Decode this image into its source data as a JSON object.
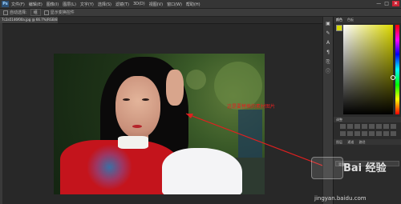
{
  "menubar": {
    "logo": "Ps",
    "items": [
      "文件(F)",
      "编辑(E)",
      "图像(I)",
      "图层(L)",
      "文字(Y)",
      "选择(S)",
      "滤镜(T)",
      "3D(D)",
      "视图(V)",
      "窗口(W)",
      "帮助(H)"
    ],
    "window_controls": [
      "—",
      "□",
      "✕"
    ]
  },
  "options_bar": {
    "auto_select_label": "自动选择:",
    "layer_dropdown": "组",
    "show_transform_label": "显示变换控件"
  },
  "document_tab": {
    "label": "7c2a5146f00a.jpg @ 66.7%(RGB/8)"
  },
  "annotation": {
    "text": "这是要替换的素材图片"
  },
  "color_panel": {
    "tabs": [
      "颜色",
      "色板"
    ],
    "foreground_color": "#d5d800",
    "accent_color": "#c4141c"
  },
  "adjustments_panel": {
    "title": "调整"
  },
  "layers_panel": {
    "title": "图层",
    "tabs": [
      "图层",
      "通道",
      "路径"
    ],
    "rows": [
      "背景"
    ]
  },
  "watermark": {
    "brand": "Bai 经验",
    "url": "jingyan.baidu.com"
  }
}
